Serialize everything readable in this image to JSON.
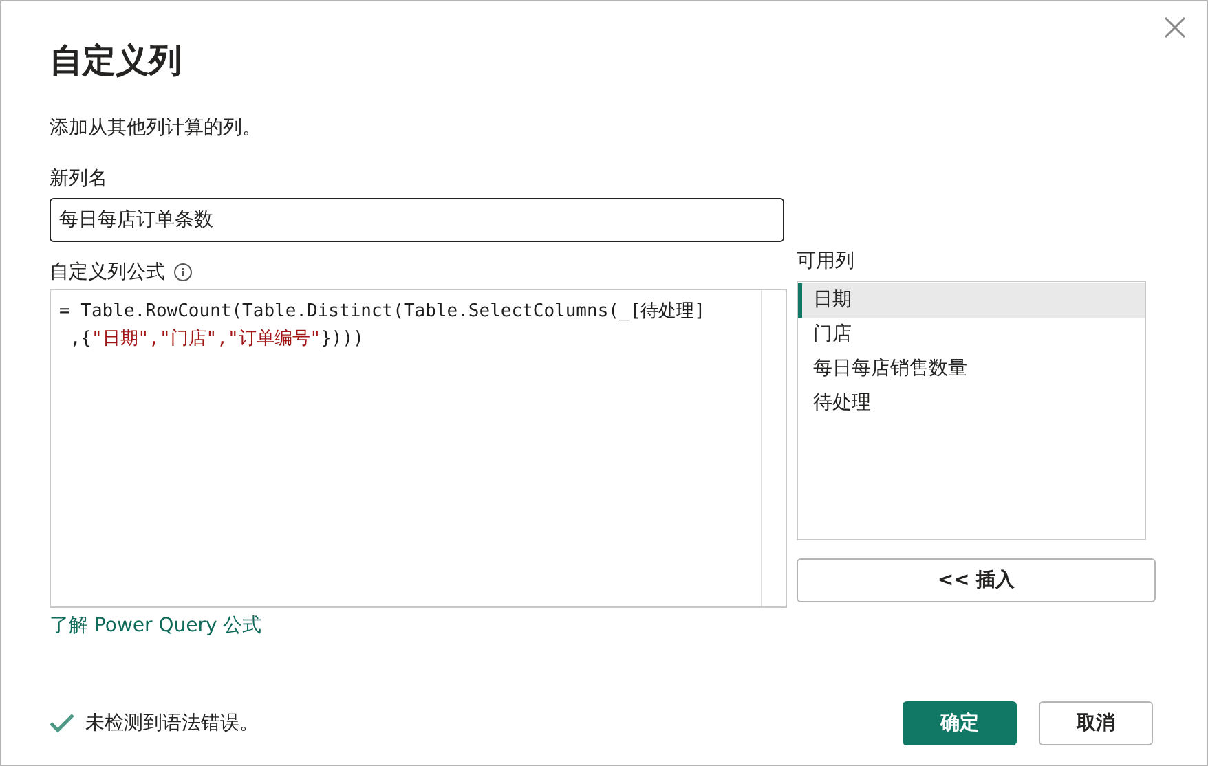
{
  "dialog": {
    "title": "自定义列",
    "description": "添加从其他列计算的列。"
  },
  "new_column_name": {
    "label": "新列名",
    "value": "每日每店订单条数"
  },
  "formula": {
    "label": "自定义列公式",
    "lines": [
      [
        {
          "text": "= Table.RowCount(Table.Distinct(Table.SelectColumns(_[待处理]",
          "kind": "code"
        }
      ],
      [
        {
          "text": " ,{",
          "kind": "code"
        },
        {
          "text": "\"日期\",",
          "kind": "string"
        },
        {
          "text": "\"门店\",",
          "kind": "string"
        },
        {
          "text": "\"订单编号\"",
          "kind": "string"
        },
        {
          "text": "})))",
          "kind": "code"
        }
      ]
    ]
  },
  "available_columns": {
    "label": "可用列",
    "items": [
      {
        "label": "日期",
        "selected": true
      },
      {
        "label": "门店",
        "selected": false
      },
      {
        "label": "每日每店销售数量",
        "selected": false
      },
      {
        "label": "待处理",
        "selected": false
      }
    ]
  },
  "insert_button": "<< 插入",
  "learn_link": "了解 Power Query 公式",
  "status": {
    "text": "未检测到语法错误。",
    "ok": true
  },
  "buttons": [
    {
      "label": "确定",
      "kind": "primary"
    },
    {
      "label": "取消",
      "kind": "secondary"
    }
  ]
}
